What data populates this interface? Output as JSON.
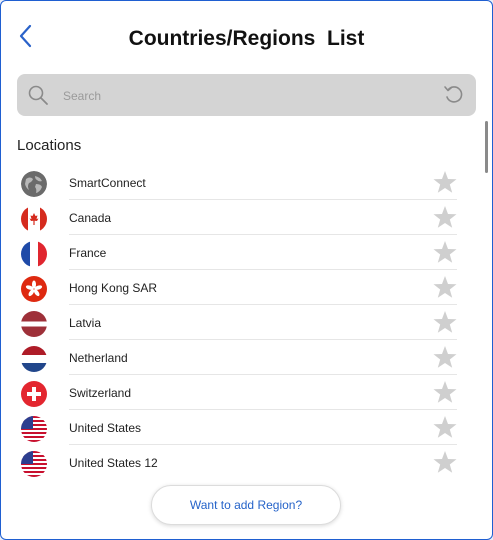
{
  "header": {
    "title": "Countries/Regions  List"
  },
  "search": {
    "placeholder": "Search"
  },
  "section": {
    "label": "Locations"
  },
  "locations": [
    {
      "name": "SmartConnect",
      "icon": "globe-icon"
    },
    {
      "name": "Canada",
      "icon": "flag-canada-icon"
    },
    {
      "name": "France",
      "icon": "flag-france-icon"
    },
    {
      "name": "Hong Kong SAR",
      "icon": "flag-hong-kong-icon"
    },
    {
      "name": "Latvia",
      "icon": "flag-latvia-icon"
    },
    {
      "name": "Netherland",
      "icon": "flag-netherlands-icon"
    },
    {
      "name": "Switzerland",
      "icon": "flag-switzerland-icon"
    },
    {
      "name": "United States",
      "icon": "flag-us-icon"
    },
    {
      "name": "United States 12",
      "icon": "flag-us-icon"
    }
  ],
  "footer": {
    "add_region_label": "Want to add Region?"
  },
  "colors": {
    "accent": "#2563c9",
    "star": "#cfcfcf",
    "search_bg": "#d4d4d4"
  }
}
